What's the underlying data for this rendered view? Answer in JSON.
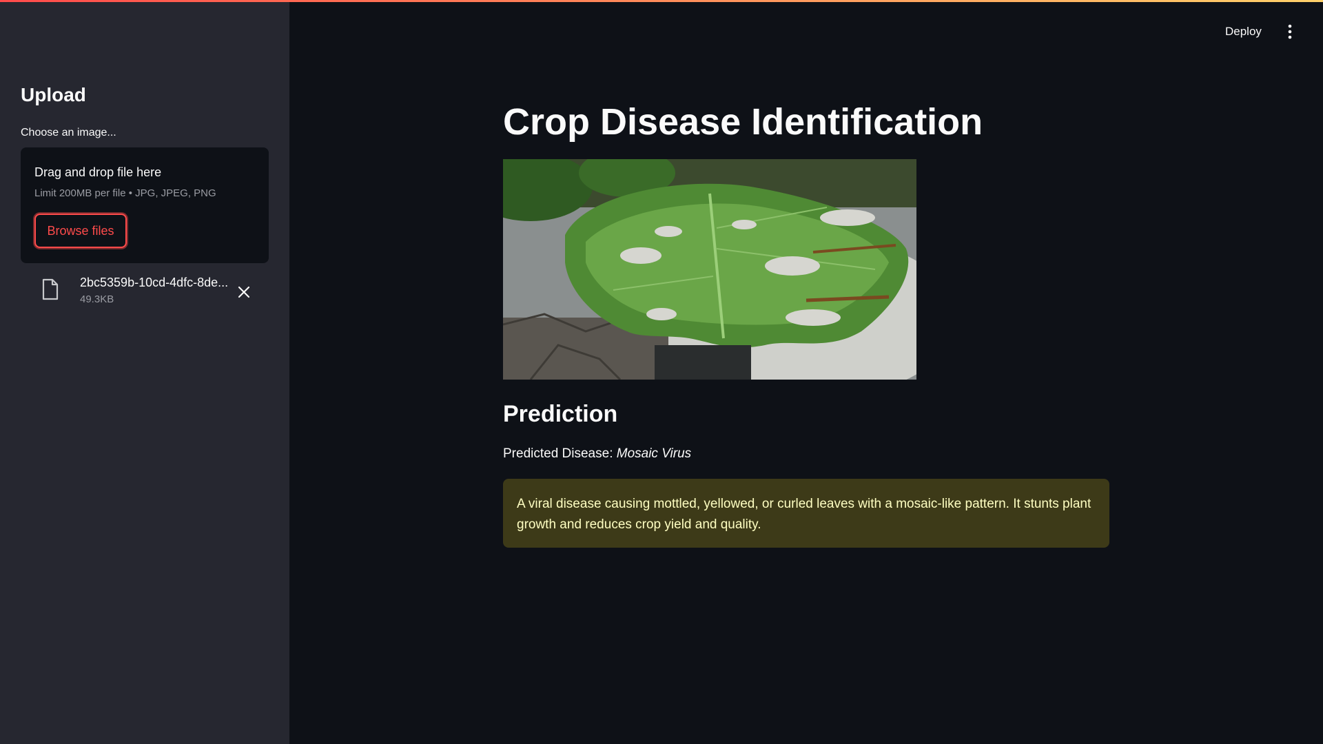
{
  "sidebar": {
    "title": "Upload",
    "uploader_label": "Choose an image...",
    "dropzone_title": "Drag and drop file here",
    "dropzone_limit": "Limit 200MB per file • JPG, JPEG, PNG",
    "browse_label": "Browse files",
    "file": {
      "name": "2bc5359b-10cd-4dfc-8de...",
      "size": "49.3KB",
      "icon": "file-icon"
    }
  },
  "header": {
    "deploy_label": "Deploy",
    "menu_icon": "vertical-ellipsis-icon"
  },
  "main": {
    "title": "Crop Disease Identification",
    "prediction_heading": "Prediction",
    "predicted_label": "Predicted Disease:",
    "predicted_value": "Mosaic Virus",
    "description": "A viral disease causing mottled, yellowed, or curled leaves with a mosaic-like pattern. It stunts plant growth and reduces crop yield and quality."
  },
  "colors": {
    "accent": "#ff4b4b",
    "sidebar_bg": "#262730",
    "main_bg": "#0e1117",
    "info_bg": "#3d3a18",
    "info_text": "#ffffc2"
  }
}
